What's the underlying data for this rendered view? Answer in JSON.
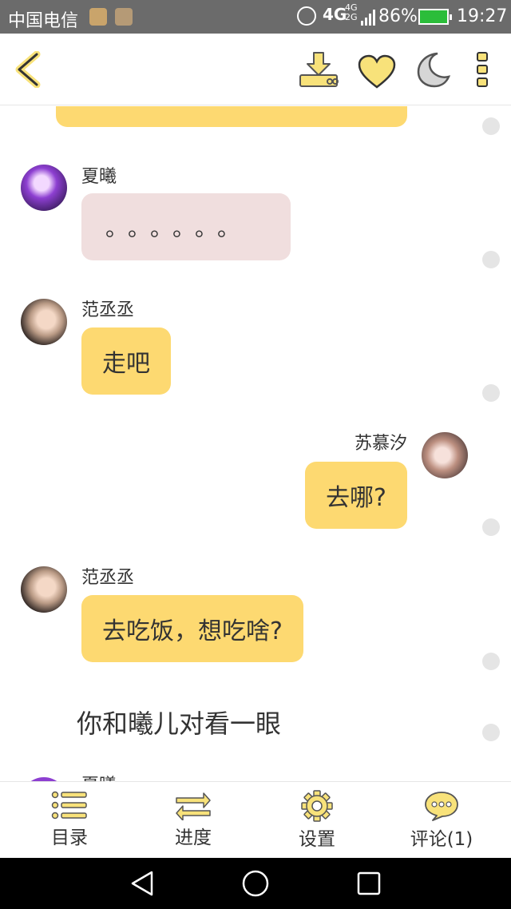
{
  "status_bar": {
    "carrier": "中国电信",
    "network": "4G",
    "network_secondary_top": "4G",
    "network_secondary_bottom": "2G",
    "battery_pct": "86%",
    "time": "19:27"
  },
  "top_bar": {
    "icons": [
      "back-icon",
      "download-icon",
      "heart-icon",
      "moon-icon",
      "more-icon"
    ],
    "accent_color": "#f8e27a"
  },
  "chat": {
    "messages": [
      {
        "sender": "夏曦",
        "text": "。。。。。。",
        "bubble": "pink",
        "side": "left"
      },
      {
        "sender": "范丞丞",
        "text": "走吧",
        "bubble": "yellow",
        "side": "left"
      },
      {
        "sender": "苏慕汐",
        "text": "去哪?",
        "bubble": "yellow",
        "side": "right"
      },
      {
        "sender": "范丞丞",
        "text": "去吃饭，想吃啥?",
        "bubble": "yellow",
        "side": "left"
      }
    ],
    "narration": "你和曦儿对看一眼",
    "cut_off_sender": "夏曦",
    "colors": {
      "bubble_yellow": "#fdd971",
      "bubble_pink": "#f0dede"
    }
  },
  "bottom_nav": {
    "items": [
      {
        "label": "目录",
        "icon": "list-icon"
      },
      {
        "label": "进度",
        "icon": "swap-arrows-icon"
      },
      {
        "label": "设置",
        "icon": "gear-icon"
      },
      {
        "label": "评论(1)",
        "icon": "comment-icon"
      }
    ]
  },
  "system_nav": {
    "icons": [
      "back-triangle-icon",
      "home-circle-icon",
      "recents-square-icon"
    ]
  }
}
